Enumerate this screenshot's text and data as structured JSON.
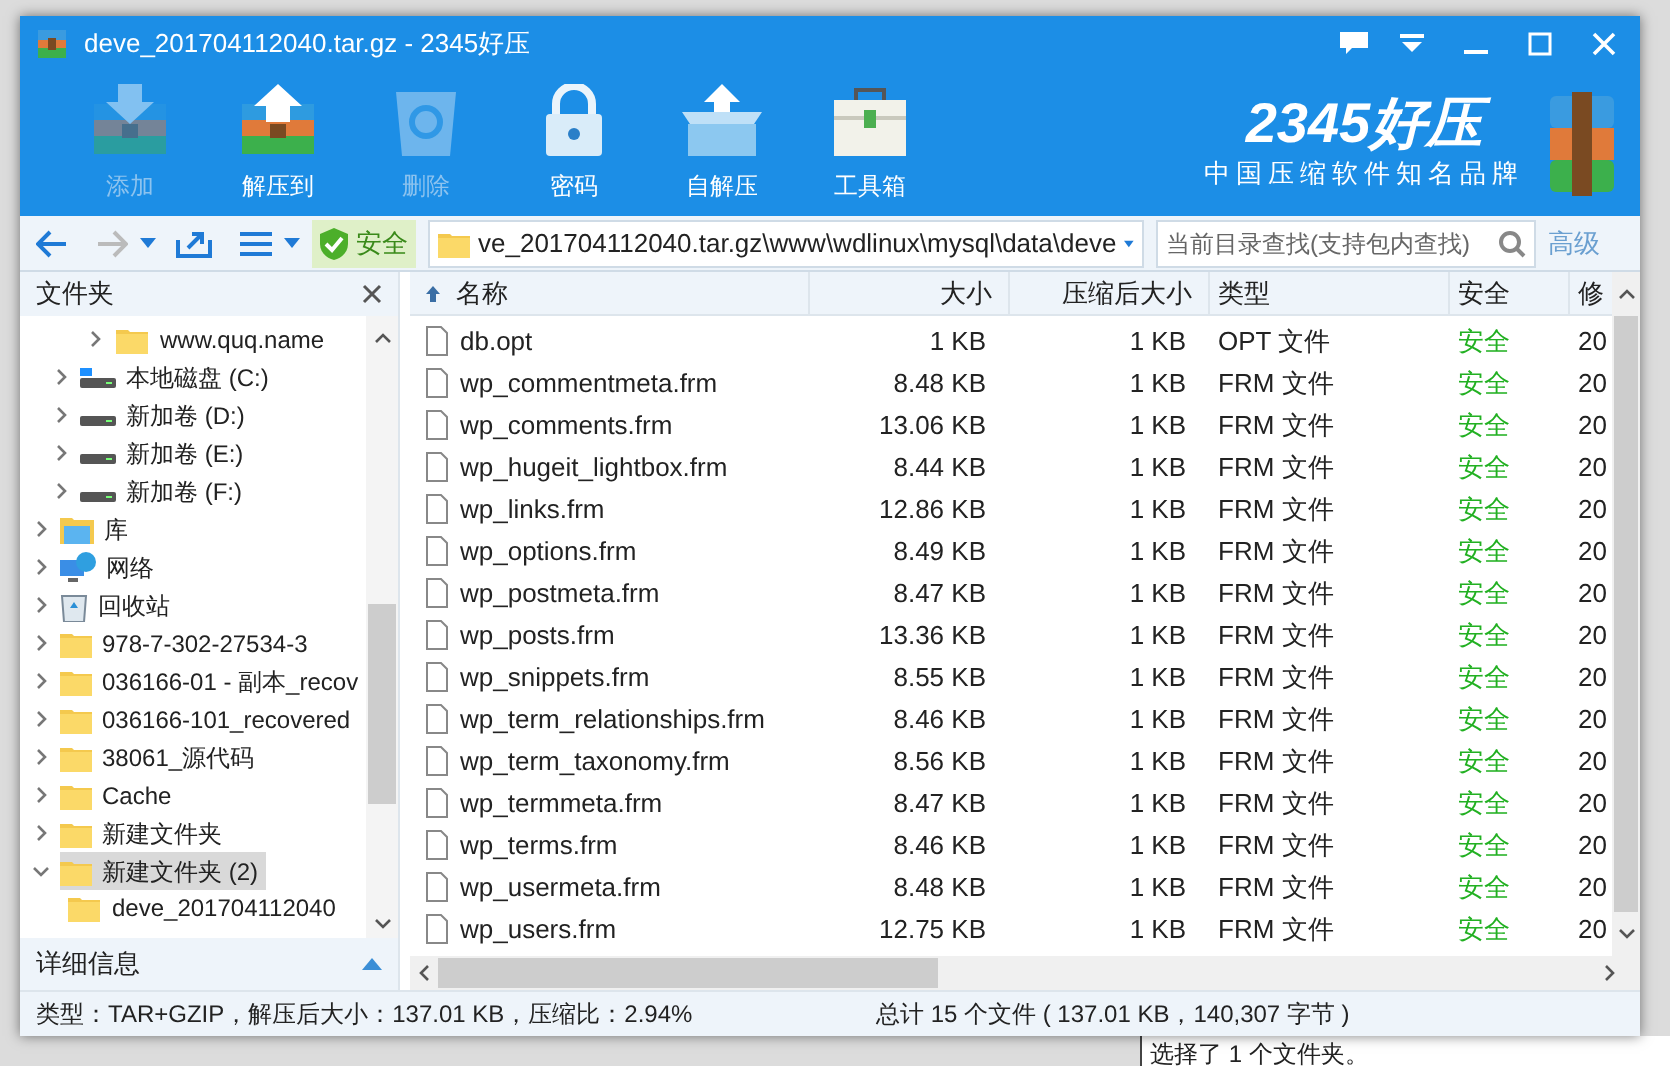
{
  "window": {
    "title": "deve_201704112040.tar.gz - 2345好压"
  },
  "toolbar": [
    {
      "label": "添加",
      "kind": "add",
      "disabled": true
    },
    {
      "label": "解压到",
      "kind": "extract",
      "disabled": false
    },
    {
      "label": "删除",
      "kind": "delete",
      "disabled": true
    },
    {
      "label": "密码",
      "kind": "lock",
      "disabled": false
    },
    {
      "label": "自解压",
      "kind": "selfextract",
      "disabled": false
    },
    {
      "label": "工具箱",
      "kind": "toolbox",
      "disabled": false
    }
  ],
  "brand": {
    "logo": "2345好压",
    "tagline": "中国压缩软件知名品牌"
  },
  "address_bar": {
    "security": "安全",
    "path": "ve_201704112040.tar.gz\\www\\wdlinux\\mysql\\data\\deve",
    "search_placeholder": "当前目录查找(支持包内查找)",
    "advanced": "高级"
  },
  "sidebar": {
    "title": "文件夹",
    "details": "详细信息",
    "scrolled_child": {
      "label": "www.quq.name",
      "kind": "folder"
    },
    "items": [
      {
        "label": "本地磁盘 (C:)",
        "kind": "system-drive",
        "expanded": false,
        "selected": false
      },
      {
        "label": "新加卷 (D:)",
        "kind": "drive",
        "expanded": false,
        "selected": false
      },
      {
        "label": "新加卷 (E:)",
        "kind": "drive",
        "expanded": false,
        "selected": false
      },
      {
        "label": "新加卷 (F:)",
        "kind": "drive",
        "expanded": false,
        "selected": false
      },
      {
        "label": "库",
        "kind": "library",
        "expanded": false,
        "selected": false
      },
      {
        "label": "网络",
        "kind": "network",
        "expanded": false,
        "selected": false
      },
      {
        "label": "回收站",
        "kind": "recycle",
        "expanded": false,
        "selected": false
      },
      {
        "label": "978-7-302-27534-3",
        "kind": "folder",
        "expanded": false,
        "selected": false
      },
      {
        "label": "036166-01 - 副本_recov",
        "kind": "folder",
        "expanded": false,
        "selected": false
      },
      {
        "label": "036166-101_recovered",
        "kind": "folder",
        "expanded": false,
        "selected": false
      },
      {
        "label": "38061_源代码",
        "kind": "folder",
        "expanded": false,
        "selected": false
      },
      {
        "label": "Cache",
        "kind": "folder",
        "expanded": false,
        "selected": false
      },
      {
        "label": "新建文件夹",
        "kind": "folder",
        "expanded": false,
        "selected": false
      },
      {
        "label": "新建文件夹 (2)",
        "kind": "folder",
        "expanded": true,
        "selected": true,
        "children": [
          {
            "label": "deve_201704112040",
            "kind": "folder"
          }
        ]
      }
    ]
  },
  "table": {
    "columns": [
      "名称",
      "大小",
      "压缩后大小",
      "类型",
      "安全",
      "修"
    ],
    "rows": [
      [
        "db.opt",
        "1 KB",
        "1 KB",
        "OPT 文件",
        "安全",
        "20"
      ],
      [
        "wp_commentmeta.frm",
        "8.48 KB",
        "1 KB",
        "FRM 文件",
        "安全",
        "20"
      ],
      [
        "wp_comments.frm",
        "13.06 KB",
        "1 KB",
        "FRM 文件",
        "安全",
        "20"
      ],
      [
        "wp_hugeit_lightbox.frm",
        "8.44 KB",
        "1 KB",
        "FRM 文件",
        "安全",
        "20"
      ],
      [
        "wp_links.frm",
        "12.86 KB",
        "1 KB",
        "FRM 文件",
        "安全",
        "20"
      ],
      [
        "wp_options.frm",
        "8.49 KB",
        "1 KB",
        "FRM 文件",
        "安全",
        "20"
      ],
      [
        "wp_postmeta.frm",
        "8.47 KB",
        "1 KB",
        "FRM 文件",
        "安全",
        "20"
      ],
      [
        "wp_posts.frm",
        "13.36 KB",
        "1 KB",
        "FRM 文件",
        "安全",
        "20"
      ],
      [
        "wp_snippets.frm",
        "8.55 KB",
        "1 KB",
        "FRM 文件",
        "安全",
        "20"
      ],
      [
        "wp_term_relationships.frm",
        "8.46 KB",
        "1 KB",
        "FRM 文件",
        "安全",
        "20"
      ],
      [
        "wp_term_taxonomy.frm",
        "8.56 KB",
        "1 KB",
        "FRM 文件",
        "安全",
        "20"
      ],
      [
        "wp_termmeta.frm",
        "8.47 KB",
        "1 KB",
        "FRM 文件",
        "安全",
        "20"
      ],
      [
        "wp_terms.frm",
        "8.46 KB",
        "1 KB",
        "FRM 文件",
        "安全",
        "20"
      ],
      [
        "wp_usermeta.frm",
        "8.48 KB",
        "1 KB",
        "FRM 文件",
        "安全",
        "20"
      ],
      [
        "wp_users.frm",
        "12.75 KB",
        "1 KB",
        "FRM 文件",
        "安全",
        "20"
      ]
    ]
  },
  "status_bar": {
    "left": "类型：TAR+GZIP，解压后大小：137.01 KB，压缩比：2.94%",
    "right": "总计 15 个文件 ( 137.01 KB，140,307 字节 )"
  },
  "background_text": "选择了 1 个文件夹。"
}
